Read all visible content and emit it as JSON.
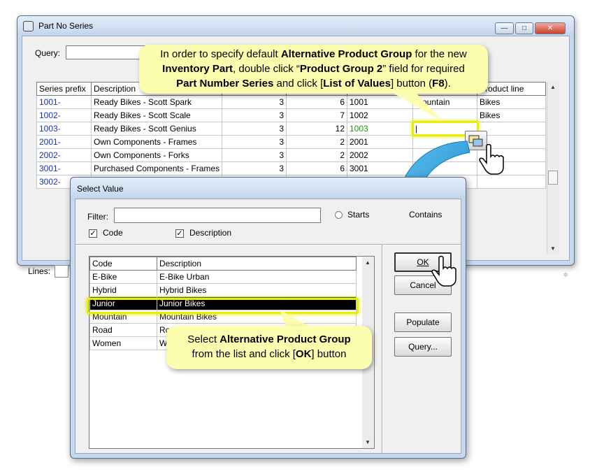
{
  "main_window": {
    "title": "Part No Series",
    "query_label": "Query:",
    "columns": [
      "Series prefix",
      "Description",
      "",
      "",
      "",
      "",
      "Product line"
    ],
    "rows": [
      {
        "prefix": "1001-",
        "description": "Ready Bikes - Scott Spark",
        "n1": "3",
        "n2": "6",
        "next": "1001",
        "group2": "Mountain",
        "product_line": "Bikes"
      },
      {
        "prefix": "1002-",
        "description": "Ready Bikes - Scott Scale",
        "n1": "3",
        "n2": "7",
        "next": "1002",
        "group2": "",
        "product_line": "Bikes"
      },
      {
        "prefix": "1003-",
        "description": "Ready Bikes - Scott Genius",
        "n1": "3",
        "n2": "12",
        "next": "1003",
        "group2": "|",
        "product_line": ""
      },
      {
        "prefix": "2001-",
        "description": "Own Components - Frames",
        "n1": "3",
        "n2": "2",
        "next": "2001",
        "group2": "",
        "product_line": ""
      },
      {
        "prefix": "2002-",
        "description": "Own Components - Forks",
        "n1": "3",
        "n2": "2",
        "next": "2002",
        "group2": "",
        "product_line": ""
      },
      {
        "prefix": "3001-",
        "description": "Purchased Components - Frames",
        "n1": "3",
        "n2": "6",
        "next": "3001",
        "group2": "",
        "product_line": ""
      },
      {
        "prefix": "3002-",
        "description": "",
        "n1": "",
        "n2": "",
        "next": "",
        "group2": "",
        "product_line": ""
      }
    ],
    "lines_label": "Lines:"
  },
  "select_dialog": {
    "title": "Select Value",
    "filter_label": "Filter:",
    "filter_value": "",
    "radio_starts": "Starts",
    "radio_contains": "Contains",
    "check_code": "Code",
    "check_description": "Description",
    "list_columns": [
      "Code",
      "Description"
    ],
    "list_rows": [
      {
        "code": "E-Bike",
        "description": "E-Bike Urban"
      },
      {
        "code": "Hybrid",
        "description": "Hybrid Bikes"
      },
      {
        "code": "Junior",
        "description": "Junior Bikes"
      },
      {
        "code": "Mountain",
        "description": "Mountain Bikes"
      },
      {
        "code": "Road",
        "description": "Ro"
      },
      {
        "code": "Women",
        "description": "W"
      }
    ],
    "selected_index": 2,
    "buttons": {
      "ok": "OK",
      "cancel": "Cancel",
      "populate": "Populate",
      "query": "Query..."
    }
  },
  "callout_top": {
    "l1a": "In order to specify default ",
    "l1b": "Alternative Product Group",
    "l1c": " for the new",
    "l2a": "Inventory Part",
    "l2b": ", double click “",
    "l2c": "Product Group 2",
    "l2d": "” field for required",
    "l3a": "Part Number Series",
    "l3b": " and click [",
    "l3c": "List of Values",
    "l3d": "] button (",
    "l3e": "F8",
    "l3f": ")."
  },
  "callout_bottom": {
    "l1a": "Select ",
    "l1b": "Alternative Product Group",
    "l2a": "from the list and click [",
    "l2b": "OK",
    "l2c": "] button"
  },
  "colors": {
    "callout": "#fdfdb0",
    "highlight": "#e6f000",
    "arrow": "#1e9ad6",
    "prefix_text": "#1a32b8",
    "next_value_green": "#1a9a1a"
  }
}
